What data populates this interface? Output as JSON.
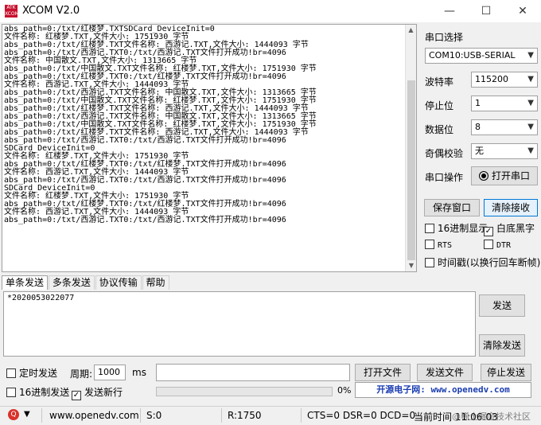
{
  "window": {
    "title": "XCOM V2.0",
    "logo_text": "ATK XCOM",
    "minimize": "—",
    "maximize": "☐",
    "close": "✕"
  },
  "receive_text": "abs_path=0:/txt/红楼梦.TXTSDCard_DeviceInit=0\n文件名称: 红楼梦.TXT,文件大小: 1751930 字节\nabs_path=0:/txt/红楼梦.TXT文件名称: 西游记.TXT,文件大小: 1444093 字节\nabs_path=0:/txt/西游记.TXT0:/txt/西游记.TXT文件打开成功!br=4096\n文件名称: 中国散文.TXT,文件大小: 1313665 字节\nabs_path=0:/txt/中国散文.TXT文件名称: 红楼梦.TXT,文件大小: 1751930 字节\nabs_path=0:/txt/红楼梦.TXT0:/txt/红楼梦.TXT文件打开成功!br=4096\n文件名称: 西游记.TXT,文件大小: 1444093 字节\nabs_path=0:/txt/西游记.TXT文件名称: 中国散文.TXT,文件大小: 1313665 字节\nabs_path=0:/txt/中国散文.TXT文件名称: 红楼梦.TXT,文件大小: 1751930 字节\nabs_path=0:/txt/红楼梦.TXT文件名称: 西游记.TXT,文件大小: 1444093 字节\nabs_path=0:/txt/西游记.TXT文件名称: 中国散文.TXT,文件大小: 1313665 字节\nabs_path=0:/txt/中国散文.TXT文件名称: 红楼梦.TXT,文件大小: 1751930 字节\nabs_path=0:/txt/红楼梦.TXT文件名称: 西游记.TXT,文件大小: 1444093 字节\nabs_path=0:/txt/西游记.TXT0:/txt/西游记.TXT文件打开成功!br=4096\nSDCard_DeviceInit=0\n文件名称: 红楼梦.TXT,文件大小: 1751930 字节\nabs_path=0:/txt/红楼梦.TXT0:/txt/红楼梦.TXT文件打开成功!br=4096\n文件名称: 西游记.TXT,文件大小: 1444093 字节\nabs_path=0:/txt/西游记.TXT0:/txt/西游记.TXT文件打开成功!br=4096\nSDCard_DeviceInit=0\n文件名称: 红楼梦.TXT,文件大小: 1751930 字节\nabs_path=0:/txt/红楼梦.TXT0:/txt/红楼梦.TXT文件打开成功!br=4096\n文件名称: 西游记.TXT,文件大小: 1444093 字节\nabs_path=0:/txt/西游记.TXT0:/txt/西游记.TXT文件打开成功!br=4096",
  "right_panel": {
    "port_select_label": "串口选择",
    "port_value": "COM10:USB-SERIAL",
    "baud_label": "波特率",
    "baud_value": "115200",
    "stop_label": "停止位",
    "stop_value": "1",
    "data_label": "数据位",
    "data_value": "8",
    "parity_label": "奇偶校验",
    "parity_value": "无",
    "port_op_label": "串口操作",
    "open_port_button": "打开串口",
    "save_window_button": "保存窗口",
    "clear_recv_button": "清除接收",
    "hex_display": "16进制显示",
    "white_black": "白底黑字",
    "rts": "RTS",
    "dtr": "DTR",
    "timestamp": "时间戳(以换行回车断帧)"
  },
  "tabs": [
    "单条发送",
    "多条发送",
    "协议传输",
    "帮助"
  ],
  "send": {
    "text": "*2020053022077",
    "send_button": "发送",
    "clear_send_button": "清除发送"
  },
  "bottom": {
    "timed_send": "定时发送",
    "period_label": "周期:",
    "period_value": "1000",
    "period_unit": "ms",
    "open_file_button": "打开文件",
    "send_file_button": "发送文件",
    "stop_send_button": "停止发送",
    "hex_send": "16进制发送",
    "send_newline": "发送新行",
    "progress_percent": "0%",
    "progress": 0,
    "banner": "开源电子网: www.openedv.com"
  },
  "statusbar": {
    "url": "www.openedv.com",
    "s_count": "S:0",
    "r_count": "R:1750",
    "signals": "CTS=0 DSR=0 DCD=0",
    "time": "当前时间 11:06:03",
    "watermark": "@稀土掘金技术社区"
  }
}
